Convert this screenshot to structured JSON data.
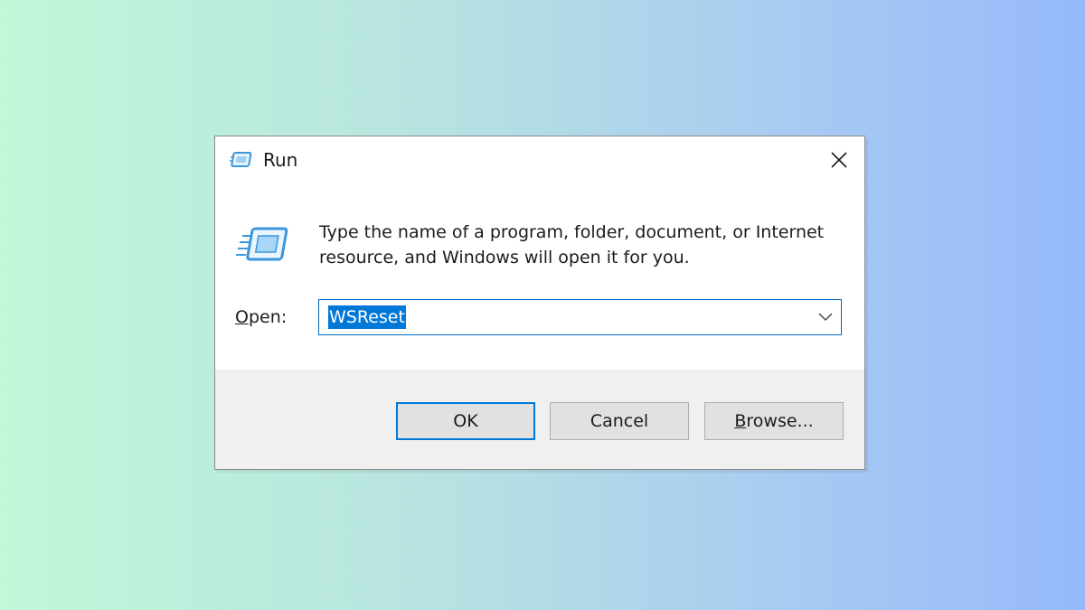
{
  "dialog": {
    "title": "Run",
    "icon": "run-icon",
    "description_line1": "Type the name of a program, folder, document, or Internet",
    "description_line2": "resource, and Windows will open it for you.",
    "open_label_accel": "O",
    "open_label_rest": "pen:",
    "open_value": "WSReset",
    "buttons": {
      "ok": "OK",
      "cancel": "Cancel",
      "browse_accel": "B",
      "browse_rest": "rowse..."
    }
  },
  "colors": {
    "accent": "#0078d7",
    "selection": "#0078d7",
    "footer_bg": "#f0f0f0",
    "background_left": "#c2f7d9",
    "background_right": "#96b9fb"
  }
}
